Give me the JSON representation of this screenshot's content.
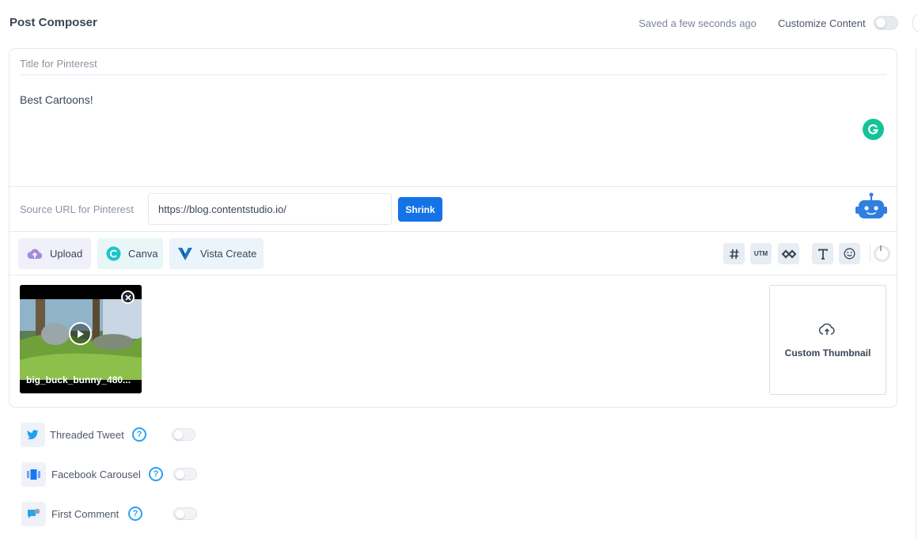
{
  "header": {
    "title": "Post Composer",
    "saved_status": "Saved a few seconds ago",
    "customize_label": "Customize Content"
  },
  "composer": {
    "title_placeholder": "Title for Pinterest",
    "body_text": "Best Cartoons!",
    "source_label": "Source URL for Pinterest",
    "source_url": "https://blog.contentstudio.io/",
    "shrink_label": "Shrink"
  },
  "toolbar": {
    "upload_label": "Upload",
    "canva_label": "Canva",
    "vista_label": "Vista Create",
    "utm_label": "UTM"
  },
  "media": {
    "file_name": "big_buck_bunny_480...",
    "custom_thumbnail_label": "Custom Thumbnail"
  },
  "options": [
    {
      "label": "Threaded Tweet"
    },
    {
      "label": "Facebook Carousel"
    },
    {
      "label": "First Comment"
    }
  ],
  "help_glyph": "?",
  "colors": {
    "accent": "#1473e6",
    "grammarly": "#15c39a",
    "help": "#2aa3ef",
    "canva": "#20c4cb",
    "vista": "#1877c5"
  }
}
